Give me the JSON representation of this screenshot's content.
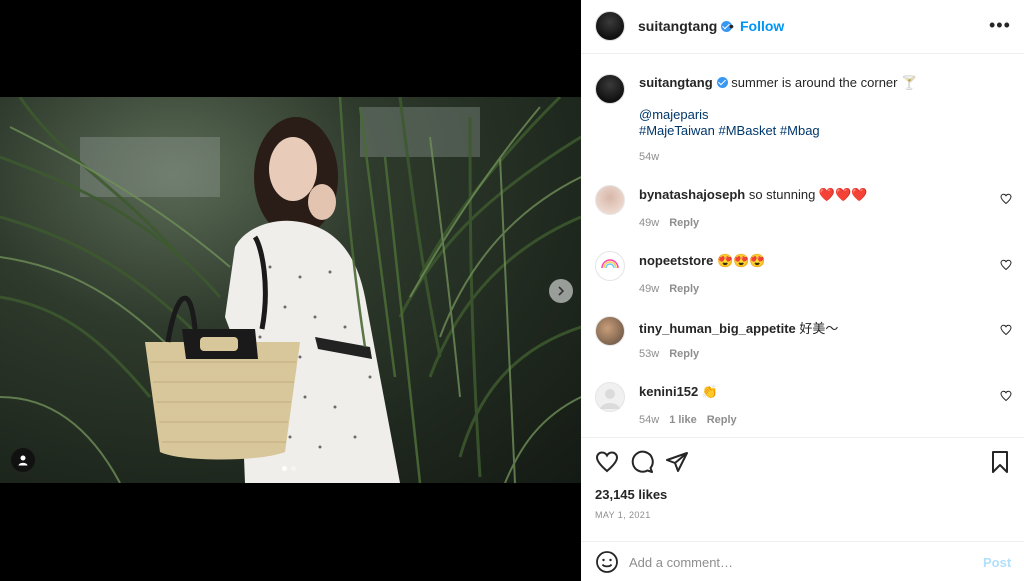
{
  "post": {
    "author": "suitangtang",
    "follow_label": "Follow",
    "separator": "•",
    "more_label": "•••"
  },
  "caption": {
    "author": "suitangtang",
    "text": "summer is around the corner 🍸",
    "mention": "@majeparis",
    "hashtags": "#MajeTaiwan #MBasket #Mbag",
    "time": "54w"
  },
  "comments": [
    {
      "user": "bynatashajoseph",
      "text": "so stunning ❤️❤️❤️",
      "time": "49w",
      "likes": "",
      "reply": "Reply"
    },
    {
      "user": "nopeetstore",
      "text": "😍😍😍",
      "time": "49w",
      "likes": "",
      "reply": "Reply"
    },
    {
      "user": "tiny_human_big_appetite",
      "text": "好美～",
      "time": "53w",
      "likes": "",
      "reply": "Reply"
    },
    {
      "user": "kenini152",
      "text": "👏",
      "time": "54w",
      "likes": "1 like",
      "reply": "Reply"
    }
  ],
  "stats": {
    "likes": "23,145 likes",
    "date": "MAY 1, 2021"
  },
  "composer": {
    "placeholder": "Add a comment…",
    "post_label": "Post"
  },
  "icons": {
    "like": "heart-icon",
    "comment": "comment-icon",
    "share": "share-icon",
    "save": "bookmark-icon",
    "emoji": "smile-icon",
    "next": "chevron-right-icon",
    "tag": "user-tag-icon"
  },
  "colors": {
    "accent": "#0095f6",
    "verified": "#3897f0",
    "muted": "#8e8e8e",
    "link": "#00376b"
  }
}
